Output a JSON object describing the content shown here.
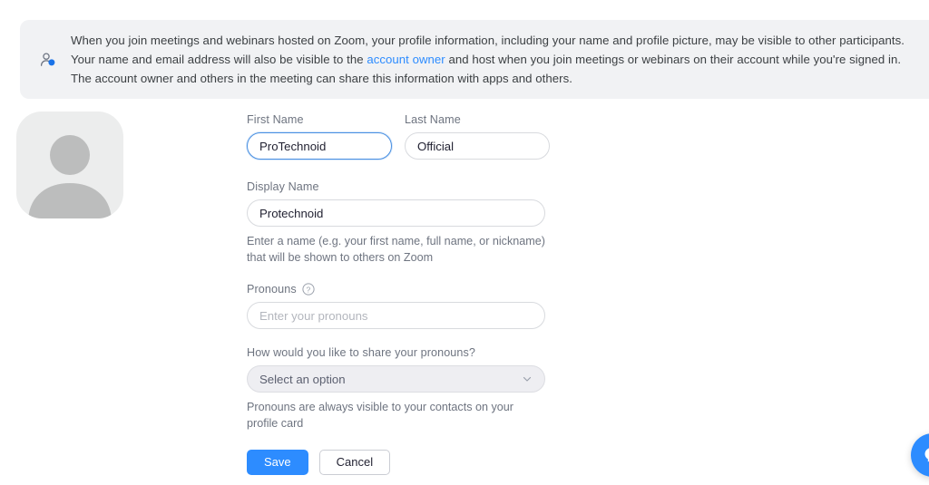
{
  "banner": {
    "icon": "privacy-person-icon",
    "text_before_link": "When you join meetings and webinars hosted on Zoom, your profile information, including your name and profile picture, may be visible to other participants. Your name and email address will also be visible to the ",
    "link_label": "account owner",
    "text_after_link": " and host when you join meetings or webinars on their account while you're signed in. The account owner and others in the meeting can share this information with apps and others.",
    "background_color": "#f1f2f4",
    "link_color": "#2d8cff"
  },
  "avatar": {
    "icon": "default-user-avatar-icon",
    "background_color": "#eceded",
    "silhouette_color": "#bcbdbd"
  },
  "form": {
    "first_name": {
      "label": "First Name",
      "value": "ProTechnoid",
      "placeholder": "",
      "focused": true
    },
    "last_name": {
      "label": "Last Name",
      "value": "Official",
      "placeholder": ""
    },
    "display_name": {
      "label": "Display Name",
      "value": "Protechnoid",
      "placeholder": "",
      "hint": "Enter a name (e.g. your first name, full name, or nickname) that will be shown to others on Zoom"
    },
    "pronouns": {
      "label": "Pronouns",
      "help_icon": "question-mark-circle-icon",
      "value": "",
      "placeholder": "Enter your pronouns"
    },
    "pronouns_sharing": {
      "label": "How would you like to share your pronouns?",
      "selected": "Select an option",
      "chevron_icon": "chevron-down-icon",
      "hint": "Pronouns are always visible to your contacts on your profile card"
    },
    "actions": {
      "save_label": "Save",
      "cancel_label": "Cancel",
      "save_color": "#2d8cff"
    }
  },
  "help_widget": {
    "icon": "help-chat-bubble-icon",
    "color": "#2d8cff"
  }
}
